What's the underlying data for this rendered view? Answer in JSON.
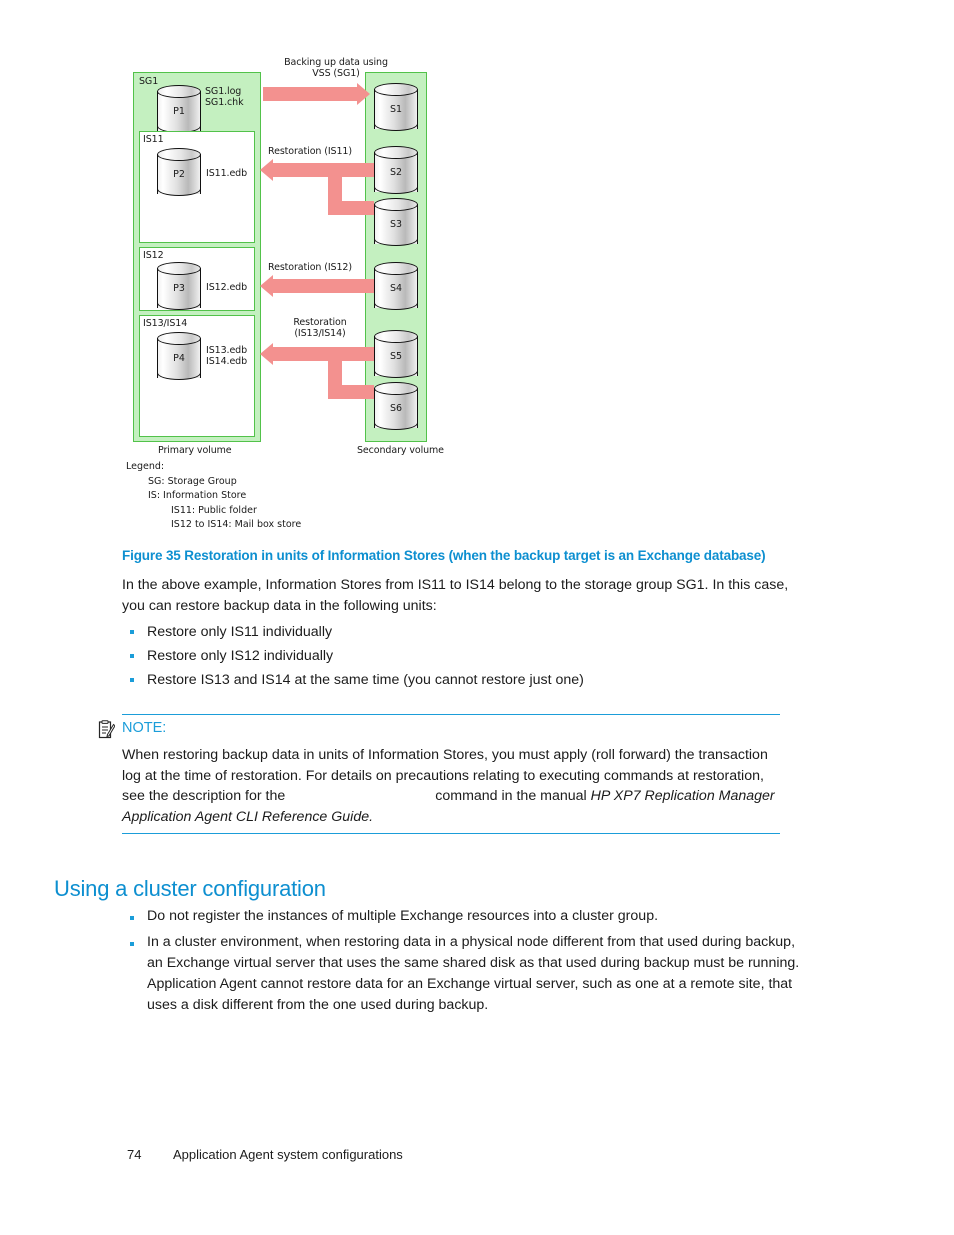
{
  "figure": {
    "caption": "Figure 35 Restoration in units of Information Stores (when the backup target is an Exchange database)",
    "diagram": {
      "primary_volume_label": "Primary volume",
      "secondary_volume_label": "Secondary volume",
      "storage_group_label": "SG1",
      "sg_files": "SG1.log\nSG1.chk",
      "groups": [
        {
          "name": "IS11",
          "cylinder": "P2",
          "files": "IS11.edb"
        },
        {
          "name": "IS12",
          "cylinder": "P3",
          "files": "IS12.edb"
        },
        {
          "name": "IS13/IS14",
          "cylinder": "P4",
          "files": "IS13.edb\nIS14.edb"
        }
      ],
      "primary_cylinders": [
        "P1",
        "P2",
        "P3",
        "P4"
      ],
      "secondary_cylinders": [
        "S1",
        "S2",
        "S3",
        "S4",
        "S5",
        "S6"
      ],
      "arrows": [
        {
          "label": "Backing up data using\nVSS (SG1)",
          "direction": "right"
        },
        {
          "label": "Restoration (IS11)",
          "direction": "left"
        },
        {
          "label": "Restoration (IS12)",
          "direction": "left"
        },
        {
          "label": "Restoration\n(IS13/IS14)",
          "direction": "left"
        }
      ],
      "colors": {
        "container_fill": "#c4f0c0",
        "container_border": "#52c24a",
        "arrow": "#f3918f"
      }
    },
    "legend": {
      "title": "Legend:",
      "lines": [
        "SG: Storage Group",
        "IS: Information Store",
        "IS11: Public folder",
        "IS12 to IS14: Mail box store"
      ]
    }
  },
  "body": {
    "intro_paragraph": "In the above example, Information Stores from IS11 to IS14 belong to the storage group SG1. In this case, you can restore backup data in the following units:",
    "restore_units": [
      "Restore only IS11 individually",
      "Restore only IS12 individually",
      "Restore IS13 and IS14 at the same time (you cannot restore just one)"
    ]
  },
  "note": {
    "title": "NOTE:",
    "icon": "note-clipboard-icon",
    "text_part1": "When restoring backup data in units of Information Stores, you must apply (roll forward) the transaction log at the time of restoration. For details on precautions relating to executing commands at restoration, see the description for the",
    "text_part2": "command in the manual",
    "manual_title": "HP XP7 Replication Manager Application Agent CLI Reference Guide."
  },
  "section": {
    "heading": "Using a cluster configuration",
    "bullets": [
      "Do not register the instances of multiple Exchange resources into a cluster group.",
      "In a cluster environment, when restoring data in a physical node different from that used during backup, an Exchange virtual server that uses the same shared disk as that used during backup must be running. Application Agent cannot restore data for an Exchange virtual server, such as one at a remote site, that uses a disk different from the one used during backup."
    ]
  },
  "footer": {
    "page_number": "74",
    "chapter_title": "Application Agent system configurations"
  },
  "colors": {
    "heading_blue": "#0d8fd0",
    "accent_blue": "#1b9dd9"
  }
}
